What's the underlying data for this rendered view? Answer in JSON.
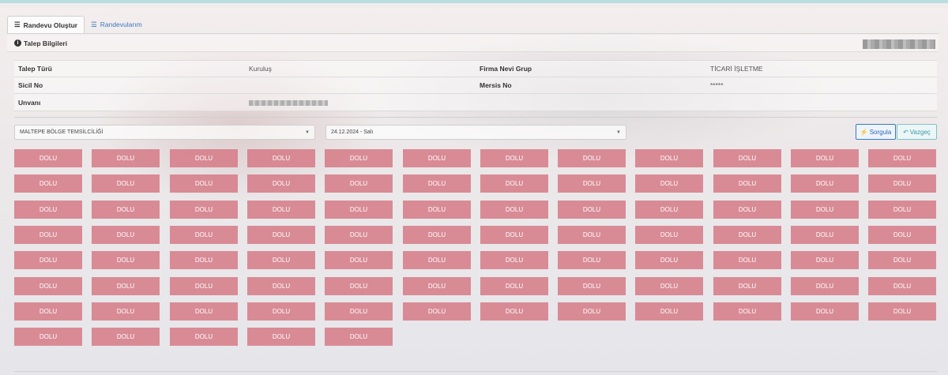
{
  "tabs": [
    {
      "label": "Randevu Oluştur",
      "icon": "list-icon",
      "active": true
    },
    {
      "label": "Randevularım",
      "icon": "list-icon",
      "active": false
    }
  ],
  "panel": {
    "title": "Talep Bilgileri",
    "icon": "info-icon"
  },
  "info": {
    "talep_turu_label": "Talep Türü",
    "talep_turu_value": "Kuruluş",
    "firma_nevi_label": "Firma Nevi Grup",
    "firma_nevi_value": "TİCARİ İŞLETME",
    "sicil_label": "Sicil No",
    "sicil_value": "",
    "mersis_label": "Mersis No",
    "mersis_value": "*****",
    "unvan_label": "Unvanı"
  },
  "filters": {
    "office": "MALTEPE BÖLGE TEMSİLCİLİĞİ",
    "date": "24.12.2024 - Salı"
  },
  "buttons": {
    "search": "Sorgula",
    "cancel": "Vazgeç"
  },
  "slots": {
    "status_label": "DOLU",
    "count": 89,
    "color": "#d47682"
  }
}
